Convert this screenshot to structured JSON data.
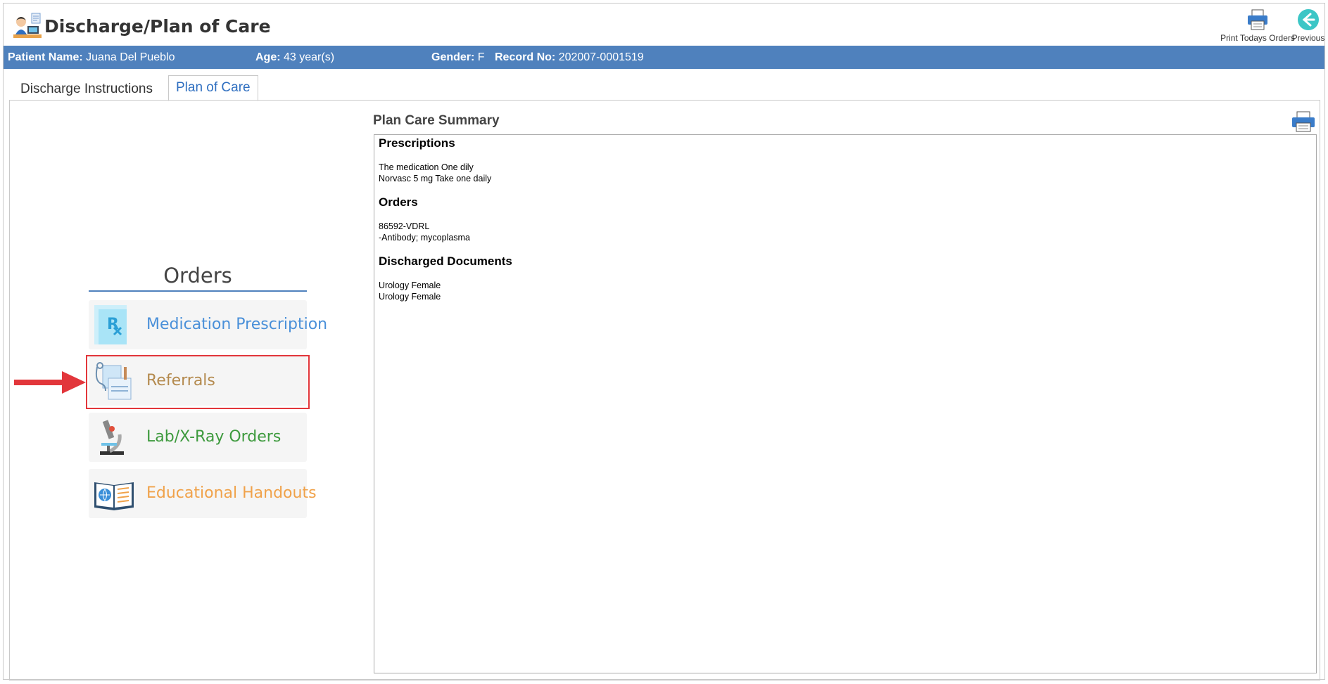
{
  "header": {
    "title": "Discharge/Plan of Care",
    "print_orders_label": "Print Todays Orders",
    "previous_label": "Previous"
  },
  "patient": {
    "name_label": "Patient Name:",
    "name": "Juana Del Pueblo",
    "age_label": "Age:",
    "age": "43 year(s)",
    "gender_label": "Gender:",
    "gender": "F",
    "record_label": "Record No:",
    "record": "202007-0001519"
  },
  "tabs": [
    {
      "label": "Discharge Instructions",
      "active": false
    },
    {
      "label": "Plan of Care",
      "active": true
    }
  ],
  "orders": {
    "title": "Orders",
    "items": [
      {
        "label": "Medication Prescription",
        "icon": "prescription-icon",
        "color": "#4a90d9"
      },
      {
        "label": "Referrals",
        "icon": "referral-icon",
        "color": "#b48a4e",
        "highlighted": true
      },
      {
        "label": "Lab/X-Ray Orders",
        "icon": "microscope-icon",
        "color": "#3d9a3d"
      },
      {
        "label": "Educational Handouts",
        "icon": "book-icon",
        "color": "#f0a24a"
      }
    ]
  },
  "summary": {
    "title": "Plan Care Summary",
    "sections": [
      {
        "heading": "Prescriptions",
        "lines": [
          "The medication One dily",
          "Norvasc 5 mg Take one daily"
        ]
      },
      {
        "heading": "Orders",
        "lines": [
          "86592-VDRL",
          "-Antibody; mycoplasma"
        ]
      },
      {
        "heading": "Discharged Documents",
        "lines": [
          "Urology Female",
          "Urology Female"
        ]
      }
    ]
  },
  "colors": {
    "accent": "#4f81bd",
    "highlight": "#e2363b"
  }
}
